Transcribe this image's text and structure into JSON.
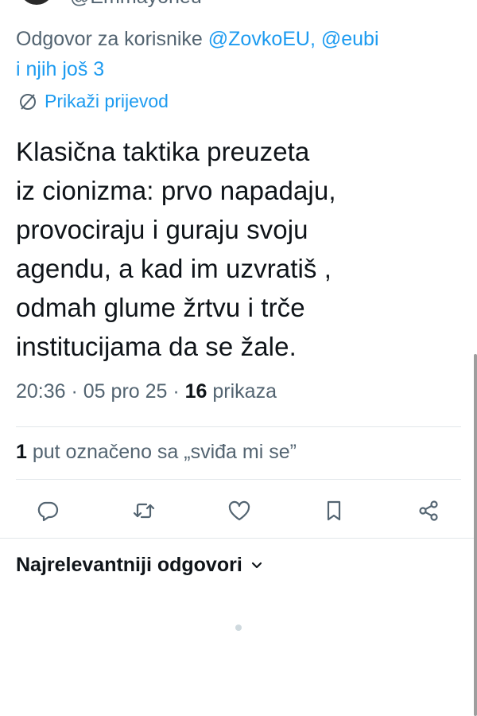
{
  "author": {
    "handle_cut": "@Emmayoneu"
  },
  "reply": {
    "prefix": "Odgovor za korisnike ",
    "mention_1": "@ZovkoEU",
    "separator": ", ",
    "mention_2": "@eubi",
    "suffix": "i njih još 3"
  },
  "translate": {
    "label": "Prikaži prijevod",
    "icon": "globe-slash-icon"
  },
  "tweet": {
    "text": "Klasična taktika preuzeta\niz cionizma: prvo napadaju,\nprovociraju i guraju svoju\nagendu, a kad im uzvratiš ,\nodmah glume žrtvu i trče\ninstitucijama da se žale."
  },
  "meta": {
    "time": "20:36",
    "sep1": " · ",
    "date": "05 pro 25",
    "sep2": " · ",
    "views_count": "16",
    "views_label": " prikaza"
  },
  "likes": {
    "count": "1",
    "label": " put označeno sa „sviđa mi se”"
  },
  "actions": [
    {
      "name": "reply",
      "icon": "comment-icon"
    },
    {
      "name": "retweet",
      "icon": "retweet-icon"
    },
    {
      "name": "like",
      "icon": "heart-icon"
    },
    {
      "name": "bookmark",
      "icon": "bookmark-icon"
    },
    {
      "name": "share",
      "icon": "share-icon"
    }
  ],
  "replies_sort": {
    "label": "Najrelevantniji odgovori",
    "icon": "chevron-down-icon"
  },
  "colors": {
    "text_primary": "#0f1419",
    "text_secondary": "#536471",
    "accent": "#1d9bf0",
    "divider": "#e1e6ea"
  }
}
